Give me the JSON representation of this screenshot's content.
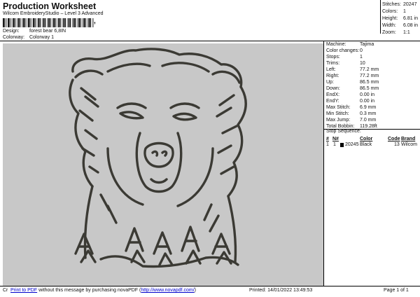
{
  "header": {
    "title": "Production Worksheet",
    "subtitle": "Wilcom EmbroideryStudio – Level 3 Advanced",
    "barcode_trailer": ","
  },
  "design_info": {
    "design_label": "Design:",
    "design_value": "forest bear 6,8IN",
    "colorway_label": "Colorway:",
    "colorway_value": "Colorway 1"
  },
  "summary": [
    {
      "label": "Stitches:",
      "value": "20247"
    },
    {
      "label": "Colors:",
      "value": "1"
    },
    {
      "label": "Height:",
      "value": "6.81 in"
    },
    {
      "label": "Width:",
      "value": "6.08 in"
    },
    {
      "label": "Zoom:",
      "value": "1:1"
    }
  ],
  "stats": [
    {
      "label": "Machine:",
      "value": "Tajima"
    },
    {
      "label": "Color changes:",
      "value": "0"
    },
    {
      "label": "Stops:",
      "value": "1"
    },
    {
      "label": "Trims:",
      "value": "10"
    },
    {
      "label": "Left:",
      "value": "77.2 mm"
    },
    {
      "label": "Right:",
      "value": "77.2 mm"
    },
    {
      "label": "Up:",
      "value": "86.5 mm"
    },
    {
      "label": "Down:",
      "value": "86.5 mm"
    },
    {
      "label": "EndX:",
      "value": "0.00 in"
    },
    {
      "label": "EndY:",
      "value": "0.00 in"
    },
    {
      "label": "Max Stitch:",
      "value": "6.9 mm"
    },
    {
      "label": "Min Stitch:",
      "value": "0.3 mm"
    },
    {
      "label": "Max Jump:",
      "value": "7.0 mm"
    },
    {
      "label": "Total Bobbin:",
      "value": "119.28ft"
    }
  ],
  "stop_sequence": {
    "title": "Stop Sequence:",
    "headers": [
      "#",
      "N#",
      "Color",
      "Code",
      "Brand"
    ],
    "rows": [
      {
        "num": "1",
        "needle": "1",
        "color_num": "20245",
        "color": "Black",
        "code": "13",
        "brand": "Wilcom",
        "swatch": "#000000"
      }
    ]
  },
  "footer": {
    "cr": "Cr",
    "print_link": "Print to PDF",
    "message": "without this message by purchasing novaPDF (",
    "url": "http://www.novapdf.com/",
    "close": ")",
    "printed": "Printed: 14/01/2022 13:49:53",
    "page": "Page 1 of 1"
  },
  "colors": {
    "canvas": "#c8c8c8",
    "thread": "#3b3a34",
    "link": "#0000cc"
  }
}
